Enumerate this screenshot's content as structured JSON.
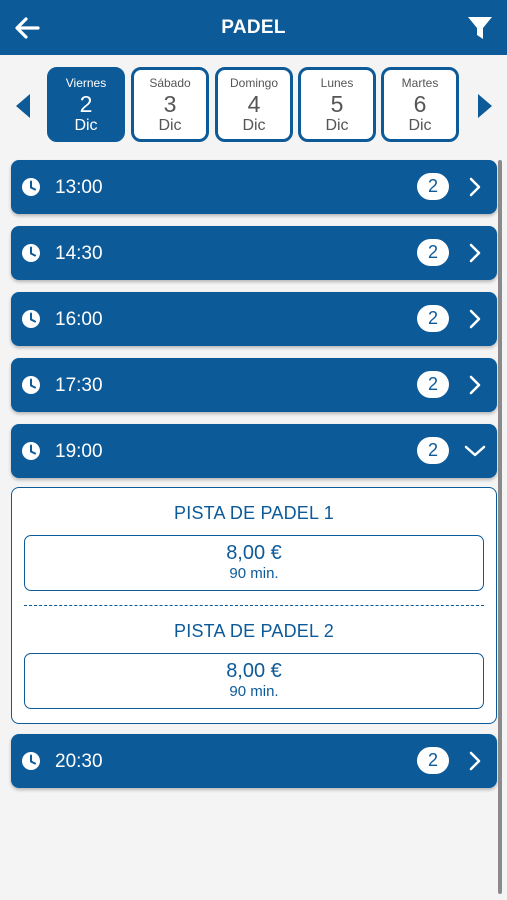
{
  "header": {
    "title": "PADEL",
    "back_icon": "arrow-left-icon",
    "filter_icon": "filter-icon"
  },
  "days": [
    {
      "name": "Viernes",
      "num": "2",
      "month": "Dic",
      "selected": true
    },
    {
      "name": "Sábado",
      "num": "3",
      "month": "Dic",
      "selected": false
    },
    {
      "name": "Domingo",
      "num": "4",
      "month": "Dic",
      "selected": false
    },
    {
      "name": "Lunes",
      "num": "5",
      "month": "Dic",
      "selected": false
    },
    {
      "name": "Martes",
      "num": "6",
      "month": "Dic",
      "selected": false
    }
  ],
  "slots": [
    {
      "time": "13:00",
      "count": "2",
      "expanded": false
    },
    {
      "time": "14:30",
      "count": "2",
      "expanded": false
    },
    {
      "time": "16:00",
      "count": "2",
      "expanded": false
    },
    {
      "time": "17:30",
      "count": "2",
      "expanded": false
    },
    {
      "time": "19:00",
      "count": "2",
      "expanded": true
    },
    {
      "time": "20:30",
      "count": "2",
      "expanded": false
    }
  ],
  "expanded_panel": {
    "courts": [
      {
        "name": "PISTA DE PADEL 1",
        "price": "8,00 €",
        "duration": "90 min."
      },
      {
        "name": "PISTA DE PADEL 2",
        "price": "8,00 €",
        "duration": "90 min."
      }
    ]
  },
  "colors": {
    "primary": "#0d5a99",
    "background": "#f4f4f4",
    "white": "#ffffff"
  }
}
